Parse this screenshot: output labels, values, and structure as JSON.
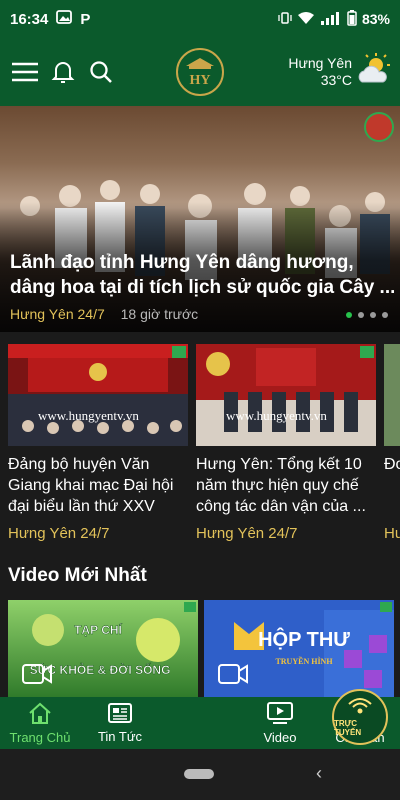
{
  "status_bar": {
    "time": "16:34",
    "battery": "83%"
  },
  "header": {
    "logo_text": "HY",
    "weather": {
      "location": "Hưng Yên",
      "temperature": "33°C",
      "icon": "partly-cloudy-icon"
    }
  },
  "hero": {
    "title_line1": "Lãnh đạo tỉnh Hưng Yên dâng hương,",
    "title_line2": "dâng hoa tại di tích lịch sử quốc gia Cây ...",
    "source": "Hưng Yên 24/7",
    "time": "18 giờ trước",
    "slide_count": 4,
    "active_slide": 1
  },
  "cards": [
    {
      "title": "Đảng bộ huyện Văn Giang khai mạc Đại hội đại biểu lần thứ XXV",
      "source": "Hưng Yên 24/7",
      "watermark": "www.hungyentv.vn"
    },
    {
      "title": "Hưng Yên: Tổng kết 10 năm thực hiện quy chế công tác dân vận của ...",
      "source": "Hưng Yên 24/7",
      "watermark": "www.hungyentv.vn"
    },
    {
      "title": "Đo... việ... ",
      "source": "Hư..."
    }
  ],
  "videos": {
    "section_title": "Video Mới Nhất",
    "items": [
      {
        "caption_line1": "TẠP CHÍ",
        "caption_line2": "SỨC KHỎE & ĐỜI SỐNG"
      },
      {
        "caption_line1": "HỘP THƯ",
        "caption_line2": "TRUYỀN HÌNH"
      }
    ]
  },
  "bottom_nav": {
    "items": [
      {
        "label": "Trang Chủ",
        "icon": "home-icon",
        "active": true
      },
      {
        "label": "Tin Tức",
        "icon": "newspaper-icon"
      },
      {
        "label": "TRỰC TUYẾN",
        "icon": "live-broadcast-icon"
      },
      {
        "label": "Video",
        "icon": "video-icon"
      },
      {
        "label": "Cá nhân",
        "icon": "user-icon"
      }
    ]
  },
  "colors": {
    "brand_green": "#0b5a2c",
    "accent_gold": "#e2c25a",
    "active_green": "#6ee06e"
  }
}
